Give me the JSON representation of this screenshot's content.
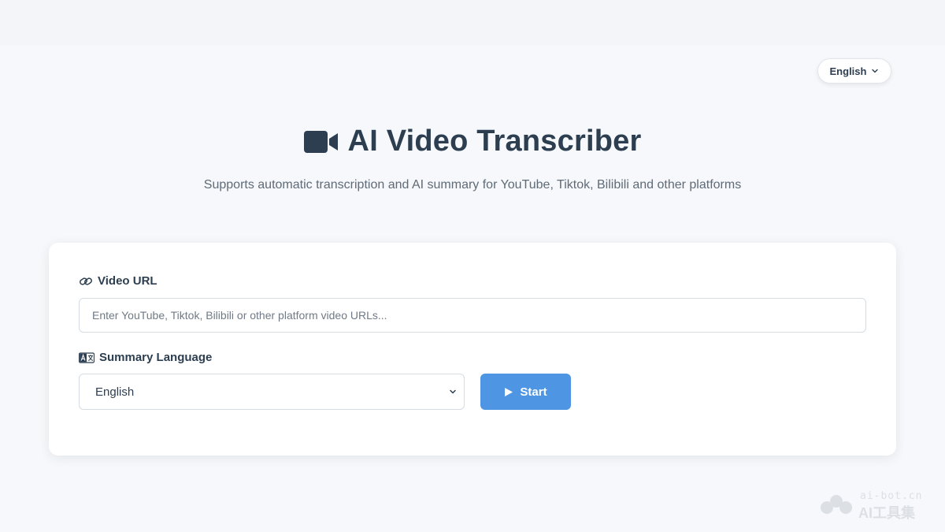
{
  "header": {
    "language_switch_label": "English"
  },
  "hero": {
    "title": "AI Video Transcriber",
    "title_icon": "video-camera-icon",
    "subtitle": "Supports automatic transcription and AI summary for YouTube, Tiktok, Bilibili and other platforms"
  },
  "form": {
    "video_url": {
      "label": "Video URL",
      "icon": "link-icon",
      "value": "",
      "placeholder": "Enter YouTube, Tiktok, Bilibili or other platform video URLs..."
    },
    "summary_language": {
      "label": "Summary Language",
      "icon": "language-icon",
      "selected": "English"
    },
    "start_button": {
      "label": "Start",
      "icon": "play-icon"
    }
  },
  "watermark": {
    "domain": "ai-bot.cn",
    "name": "AI工具集"
  },
  "colors": {
    "accent": "#4e96e3",
    "text": "#2c3e50",
    "background": "#f6f8fb"
  }
}
